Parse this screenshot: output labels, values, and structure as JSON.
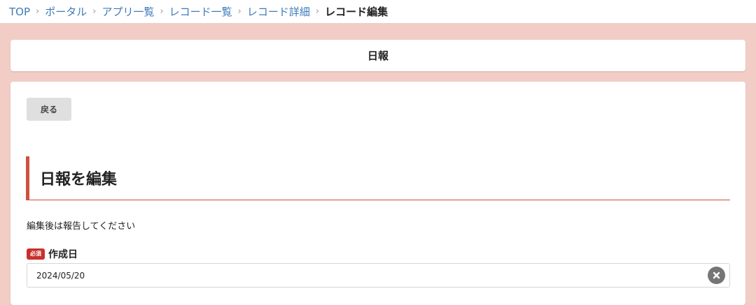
{
  "breadcrumb": {
    "items": [
      "TOP",
      "ポータル",
      "アプリ一覧",
      "レコード一覧",
      "レコード詳細"
    ],
    "current": "レコード編集",
    "separator": "›"
  },
  "app_title": "日報",
  "back_button": "戻る",
  "section_heading": "日報を編集",
  "description": "編集後は報告してください",
  "fields": {
    "created_date": {
      "required_badge": "必須",
      "label": "作成日",
      "value": "2024/05/20"
    }
  },
  "icons": {
    "clear": "close-circle-icon"
  },
  "colors": {
    "background": "#f1cdc6",
    "accent": "#d0503e",
    "link": "#3d7ab8",
    "required": "#c9302c"
  }
}
